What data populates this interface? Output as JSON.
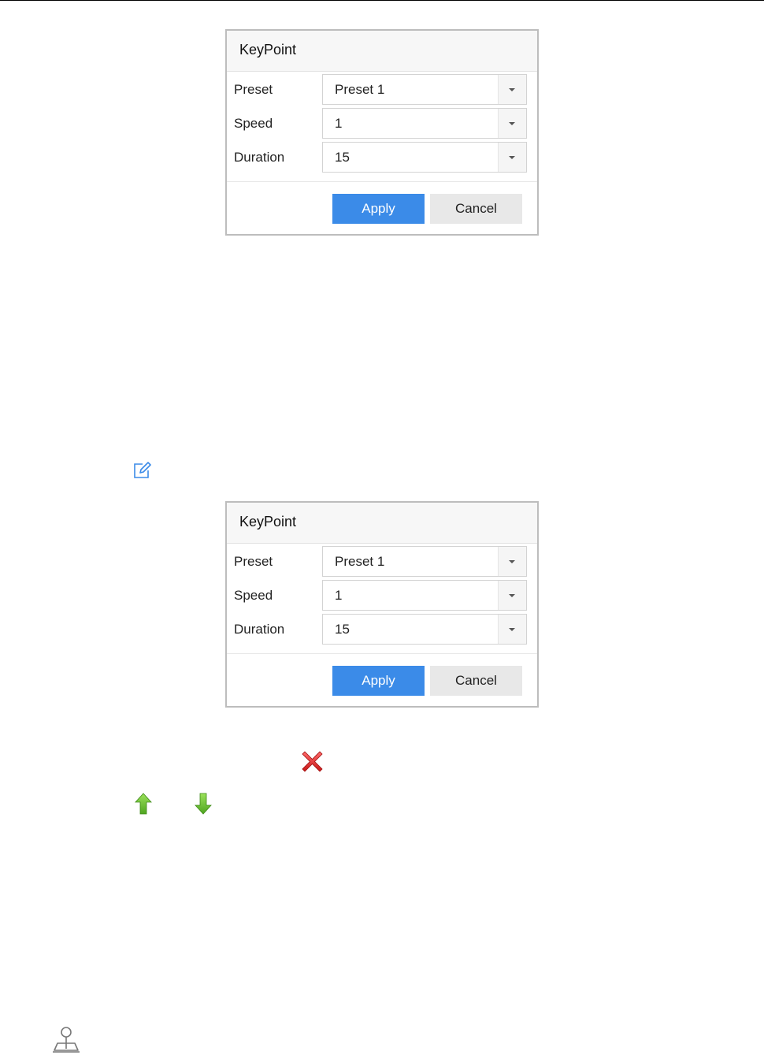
{
  "dialogs": [
    {
      "title": "KeyPoint",
      "fields": [
        {
          "label": "Preset",
          "value": "Preset 1"
        },
        {
          "label": "Speed",
          "value": "1"
        },
        {
          "label": "Duration",
          "value": "15"
        }
      ],
      "apply_label": "Apply",
      "cancel_label": "Cancel"
    },
    {
      "title": "KeyPoint",
      "fields": [
        {
          "label": "Preset",
          "value": "Preset 1"
        },
        {
          "label": "Speed",
          "value": "1"
        },
        {
          "label": "Duration",
          "value": "15"
        }
      ],
      "apply_label": "Apply",
      "cancel_label": "Cancel"
    }
  ],
  "icons": {
    "edit": "edit-icon",
    "delete": "delete-icon",
    "move_up": "arrow-up-icon",
    "move_down": "arrow-down-icon",
    "ptz": "joystick-icon"
  },
  "colors": {
    "accent": "#3b8be8",
    "delete": "#e02020",
    "arrows": "#6cbf2a"
  }
}
